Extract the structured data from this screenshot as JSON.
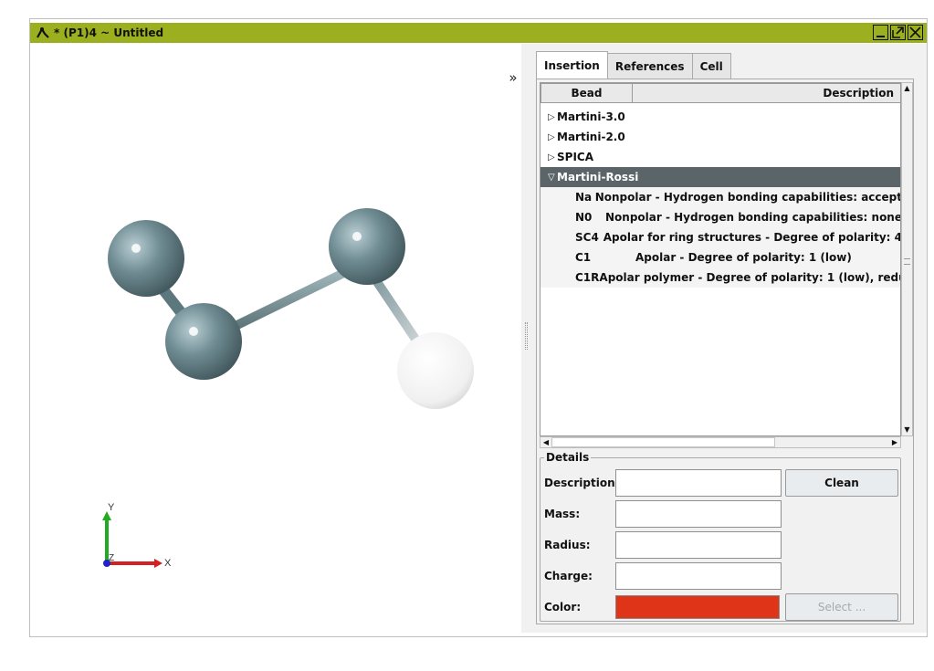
{
  "window": {
    "title": "* (P1)4 ~ Untitled",
    "title_bar_color": "#9caf1e",
    "icons": {
      "app": "molecule-app-icon",
      "minimize": "minimize-icon",
      "maximize": "maximize-icon",
      "close": "close-icon"
    }
  },
  "viewport": {
    "expand_glyph": "»",
    "axes": {
      "x_label": "X",
      "y_label": "Y",
      "z_label": "Z"
    },
    "colors": {
      "bead": "#6f8c93",
      "bond": "#6f8c93",
      "highlight_bead": "#f2f2f2",
      "x_axis": "#d42020",
      "y_axis": "#22aa22",
      "z_axis": "#2222cc"
    }
  },
  "panel": {
    "tabs": [
      {
        "label": "Insertion",
        "active": true
      },
      {
        "label": "References",
        "active": false
      },
      {
        "label": "Cell",
        "active": false
      }
    ],
    "tree": {
      "columns": {
        "bead": "Bead",
        "description": "Description"
      },
      "groups": [
        {
          "label": "Martini-3.0",
          "expanded": false
        },
        {
          "label": "Martini-2.0",
          "expanded": false
        },
        {
          "label": "SPICA",
          "expanded": false
        },
        {
          "label": "Martini-Rossi",
          "expanded": true
        }
      ],
      "children": [
        {
          "bead": "Na",
          "description": "Nonpolar - Hydrogen bonding capabilities: accept"
        },
        {
          "bead": "N0",
          "description": "Nonpolar - Hydrogen bonding capabilities: none"
        },
        {
          "bead": "SC4",
          "description": "Apolar for ring structures - Degree of polarity: 4"
        },
        {
          "bead": "C1",
          "description": "Apolar - Degree of polarity: 1 (low)"
        },
        {
          "bead": "C1R",
          "description": "Apolar polymer - Degree of polarity: 1 (low), redu"
        }
      ],
      "selected_color": "#5b6569"
    },
    "details": {
      "legend": "Details",
      "description_label": "Description:",
      "mass_label": "Mass:",
      "radius_label": "Radius:",
      "charge_label": "Charge:",
      "color_label": "Color:",
      "description_value": "",
      "mass_value": "",
      "radius_value": "",
      "charge_value": "",
      "color_value": "#e03418",
      "clean_button": "Clean",
      "select_button": "Select ..."
    }
  }
}
